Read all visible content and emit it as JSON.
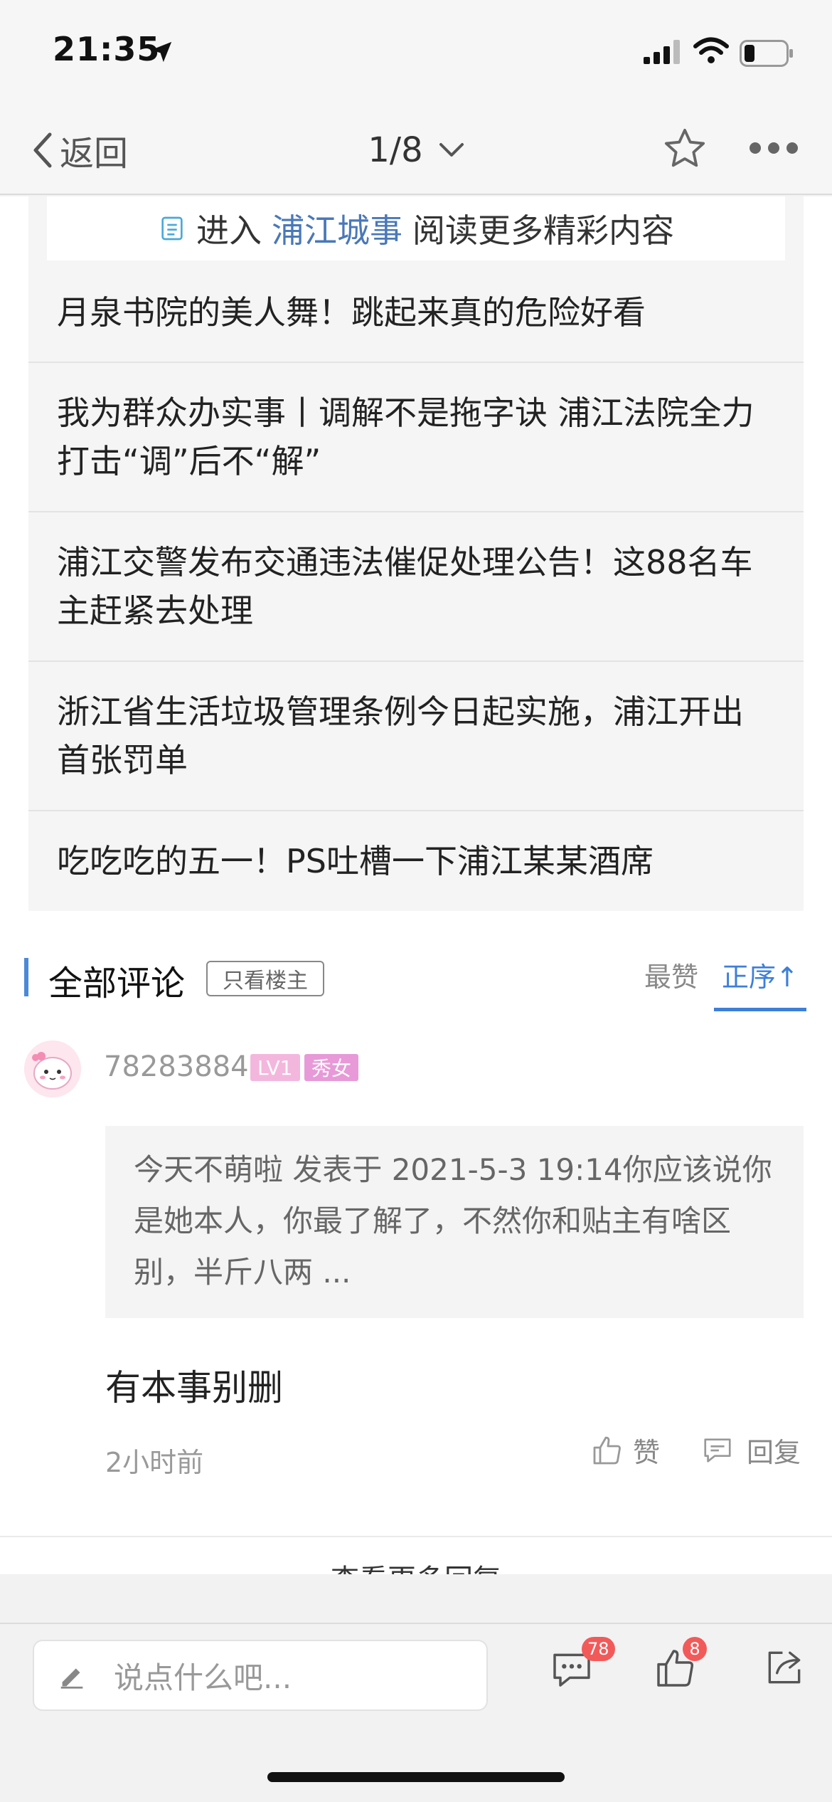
{
  "status": {
    "time": "21:35"
  },
  "nav": {
    "back_label": "返回",
    "page_indicator": "1/8"
  },
  "promo": {
    "prefix": "进入",
    "link": "浦江城事",
    "suffix": "阅读更多精彩内容"
  },
  "related_topics": [
    "月泉书院的美人舞！跳起来真的危险好看",
    "我为群众办实事丨调解不是拖字诀 浦江法院全力打击“调”后不“解”",
    "浦江交警发布交通违法催促处理公告！这88名车主赶紧去处理",
    "浙江省生活垃圾管理条例今日起实施，浦江开出首张罚单",
    "吃吃吃的五一！PS吐槽一下浦江某某酒席"
  ],
  "comments_section": {
    "title": "全部评论",
    "only_host": "只看楼主",
    "sort_hot": "最赞",
    "sort_asc": "正序↑"
  },
  "comment": {
    "username": "78283884",
    "level": "LV1",
    "title_badge": "秀女",
    "quote": "今天不萌啦 发表于 2021-5-3 19:14你应该说你是她本人，你最了解了，不然你和贴主有啥区别，半斤八两 ...",
    "text": "有本事别删",
    "time": "2小时前",
    "like_label": "赞",
    "reply_label": "回复"
  },
  "more_replies": "查看更多回复",
  "bottom": {
    "input_placeholder": "说点什么吧...",
    "comment_count": "78",
    "like_count": "8"
  },
  "colors": {
    "accent": "#3d7fd9",
    "link": "#4a78b8",
    "badge_red": "#f25a5a"
  },
  "icons": [
    "location-arrow-icon",
    "signal-icon",
    "wifi-icon",
    "battery-icon",
    "back-chevron-icon",
    "dropdown-chevron-icon",
    "star-icon",
    "more-icon",
    "document-icon",
    "thumb-up-icon",
    "reply-icon",
    "pen-icon",
    "comment-icon",
    "share-icon"
  ]
}
